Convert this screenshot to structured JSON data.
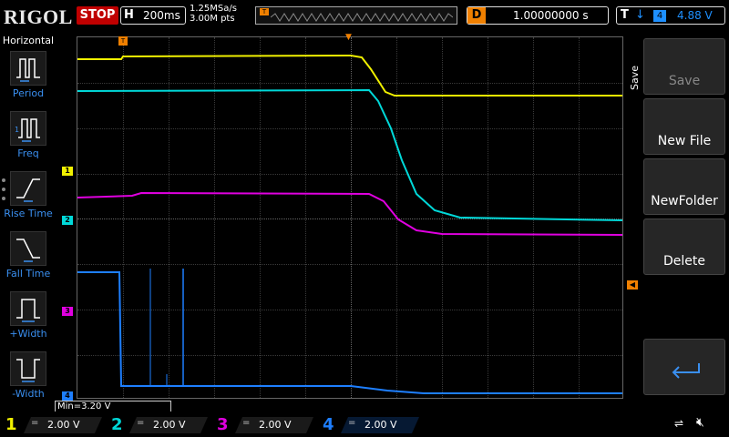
{
  "header": {
    "brand": "RIGOL",
    "run_state": "STOP",
    "horizontal_label": "H",
    "timebase": "200ms",
    "sample_rate": "1.25MSa/s",
    "points": "3.00M pts",
    "delay_label": "D",
    "delay_value": "1.00000000 s",
    "trigger_label": "T",
    "trigger_source": "4",
    "trigger_level": "4.88 V",
    "trigger_marker": "T"
  },
  "sidebar": {
    "title": "Horizontal",
    "items": [
      {
        "label": "Period",
        "icon": "period-icon"
      },
      {
        "label": "Freq",
        "icon": "freq-icon"
      },
      {
        "label": "Rise Time",
        "icon": "rise-time-icon"
      },
      {
        "label": "Fall Time",
        "icon": "fall-time-icon"
      },
      {
        "label": "+Width",
        "icon": "pos-width-icon"
      },
      {
        "label": "-Width",
        "icon": "neg-width-icon"
      }
    ]
  },
  "channel_markers": [
    "1",
    "2",
    "3",
    "4"
  ],
  "measurement": {
    "min_label": "Min=3.20 V"
  },
  "panel": {
    "title": "Save",
    "buttons": [
      {
        "label": "Save",
        "enabled": false
      },
      {
        "label": "New File",
        "enabled": true
      },
      {
        "label": "NewFolder",
        "enabled": true
      },
      {
        "label": "Delete",
        "enabled": true
      }
    ],
    "return_icon": "return-icon"
  },
  "channels": [
    {
      "num": "1",
      "scale": "2.00 V",
      "color": "#f0f000"
    },
    {
      "num": "2",
      "scale": "2.00 V",
      "color": "#00d8d8"
    },
    {
      "num": "3",
      "scale": "2.00 V",
      "color": "#e000e0"
    },
    {
      "num": "4",
      "scale": "2.00 V",
      "color": "#1e7fff"
    }
  ],
  "status_icons": [
    "usb-icon",
    "speaker-mute-icon"
  ]
}
